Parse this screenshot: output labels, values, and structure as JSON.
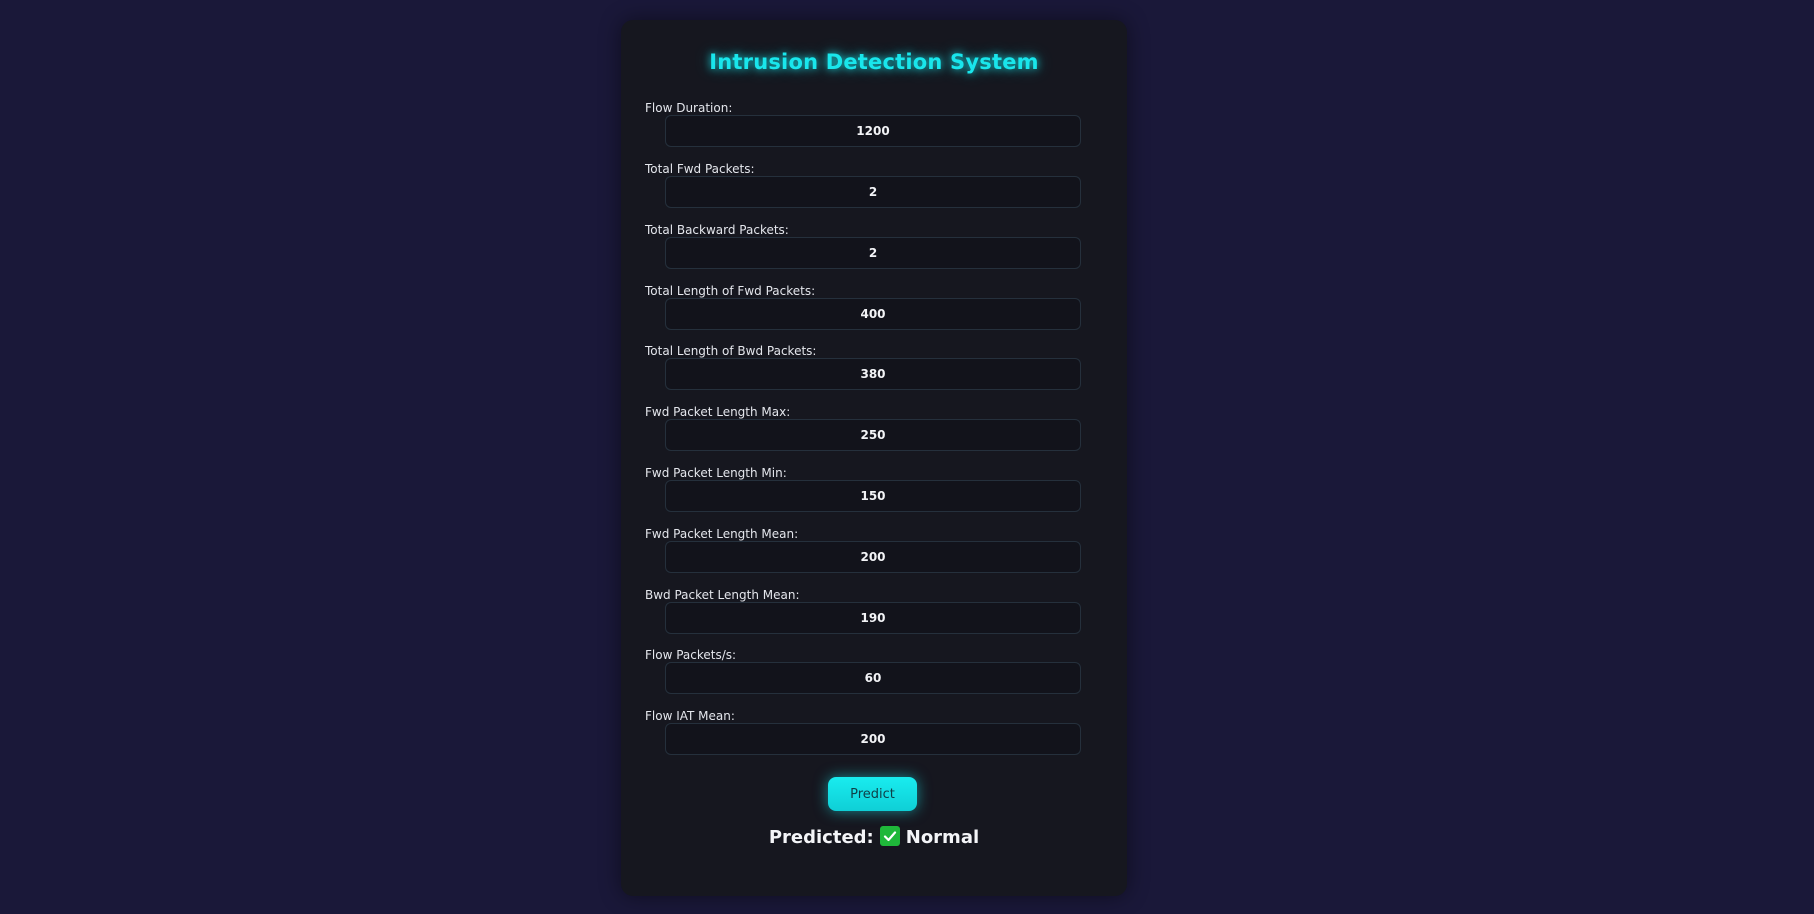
{
  "title": "Intrusion Detection System",
  "fields": [
    {
      "label": "Flow Duration:",
      "value": "1200"
    },
    {
      "label": "Total Fwd Packets:",
      "value": "2"
    },
    {
      "label": "Total Backward Packets:",
      "value": "2"
    },
    {
      "label": "Total Length of Fwd Packets:",
      "value": "400"
    },
    {
      "label": "Total Length of Bwd Packets:",
      "value": "380"
    },
    {
      "label": "Fwd Packet Length Max:",
      "value": "250"
    },
    {
      "label": "Fwd Packet Length Min:",
      "value": "150"
    },
    {
      "label": "Fwd Packet Length Mean:",
      "value": "200"
    },
    {
      "label": "Bwd Packet Length Mean:",
      "value": "190"
    },
    {
      "label": "Flow Packets/s:",
      "value": "60"
    },
    {
      "label": "Flow IAT Mean:",
      "value": "200"
    }
  ],
  "predict_button": "Predict",
  "result": {
    "prefix": "Predicted:",
    "icon": "check-mark-icon",
    "value": "Normal"
  },
  "colors": {
    "background": "#1a1839",
    "card": "#16171f",
    "accent": "#19e6ec",
    "success": "#1fb83a"
  }
}
